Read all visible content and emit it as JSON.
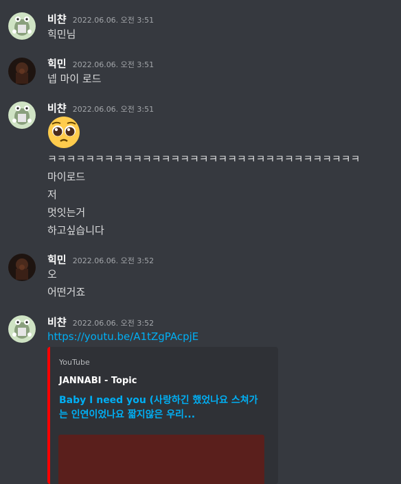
{
  "messages": [
    {
      "author": "비챤",
      "timestamp": "2022.06.06. 오전 3:51",
      "avatar": "green-character-avatar",
      "lines": [
        "힉민님"
      ]
    },
    {
      "author": "힉민",
      "timestamp": "2022.06.06. 오전 3:51",
      "avatar": "dark-figure-avatar",
      "lines": [
        "넵 마이 로드"
      ]
    },
    {
      "author": "비챤",
      "timestamp": "2022.06.06. 오전 3:51",
      "avatar": "green-character-avatar",
      "emoji": "pleading-face-emoji",
      "lines": [
        "ㅋㅋㅋㅋㅋㅋㅋㅋㅋㅋㅋㅋㅋㅋㅋㅋㅋㅋㅋㅋㅋㅋㅋㅋㅋㅋㅋㅋㅋㅋㅋㅋㅋ",
        "마이로드",
        "저",
        "멋잇는거",
        "하고싶습니다"
      ]
    },
    {
      "author": "힉민",
      "timestamp": "2022.06.06. 오전 3:52",
      "avatar": "dark-figure-avatar",
      "lines": [
        "오",
        "어떤거죠"
      ]
    },
    {
      "author": "비챤",
      "timestamp": "2022.06.06. 오전 3:52",
      "avatar": "green-character-avatar",
      "link": "https://youtu.be/A1tZgPAcpjE",
      "embed": {
        "provider": "YouTube",
        "author": "JANNABI - Topic",
        "title": "Baby I need you (사랑하긴 했었나요 스쳐가는 인연이었나요 짧지않은 우리..."
      }
    }
  ],
  "colors": {
    "background": "#36393f",
    "username": "#ffffff",
    "timestamp": "#a3a6aa",
    "text": "#dcddde",
    "link": "#00aff4",
    "embed_bg": "#2f3136",
    "embed_accent": "#ff0000"
  }
}
